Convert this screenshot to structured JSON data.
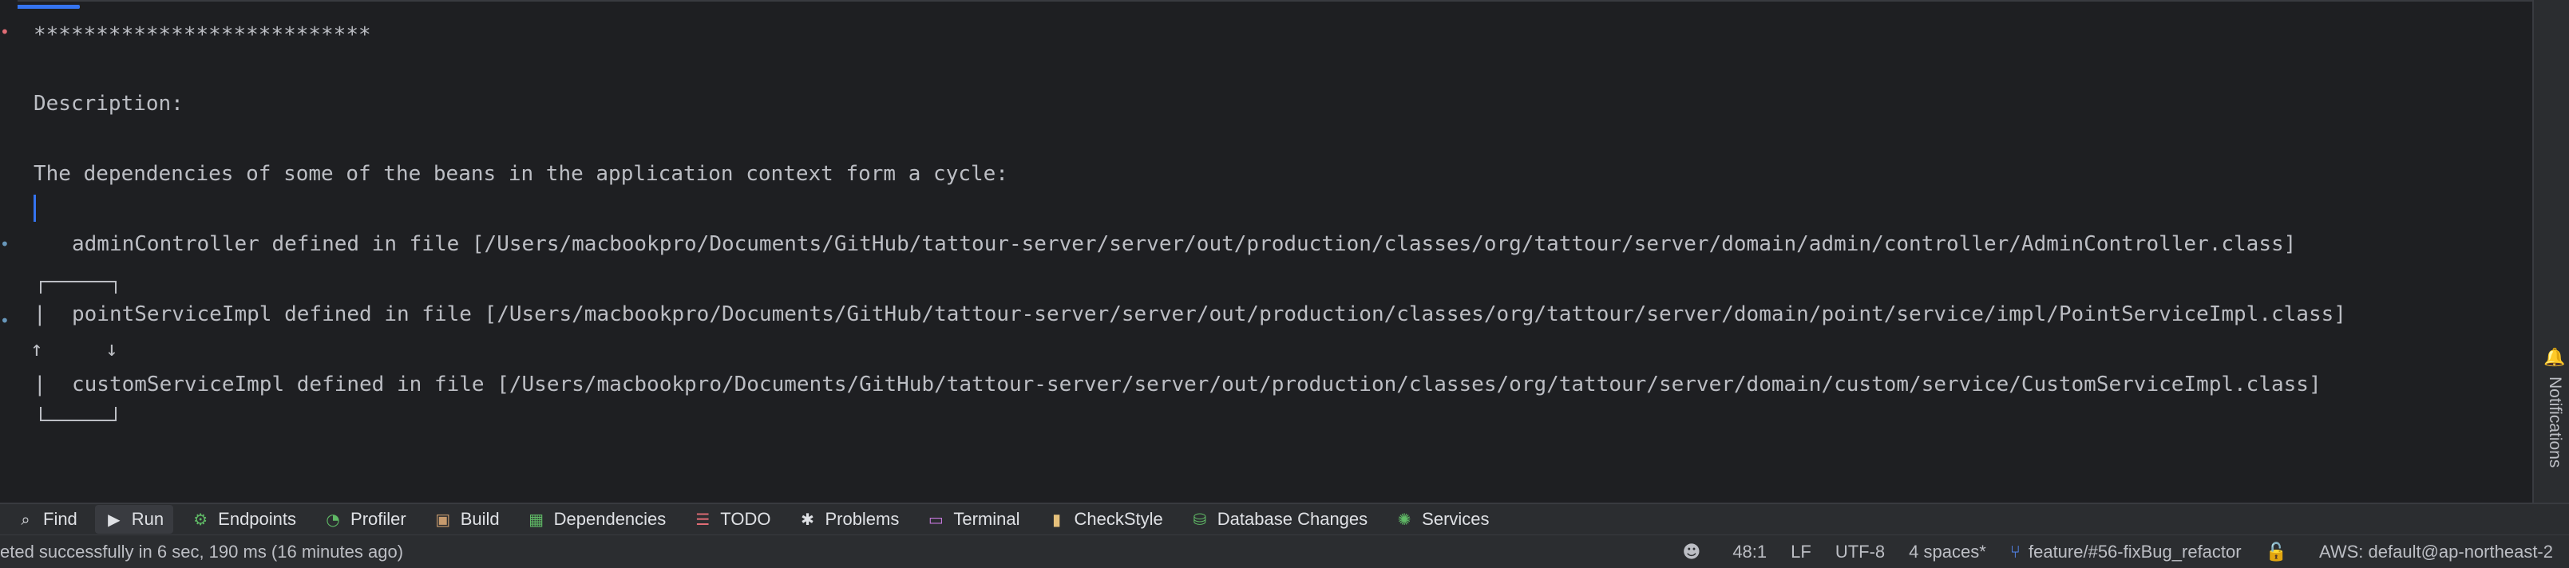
{
  "console": {
    "lines": [
      "***************************",
      "Description:",
      "The dependencies of some of the beans in the application context form a cycle:",
      "adminController defined in file [/Users/macbookpro/Documents/GitHub/tattour-server/server/out/production/classes/org/tattour/server/domain/admin/controller/AdminController.class]",
      "pointServiceImpl defined in file [/Users/macbookpro/Documents/GitHub/tattour-server/server/out/production/classes/org/tattour/server/domain/point/service/impl/PointServiceImpl.class]",
      "customServiceImpl defined in file [/Users/macbookpro/Documents/GitHub/tattour-server/server/out/production/classes/org/tattour/server/domain/custom/service/CustomServiceImpl.class]"
    ],
    "cycle_glyphs": {
      "bar": "|",
      "up": "↑",
      "down": "↓"
    }
  },
  "right_strip": {
    "notifications_label": "Notifications",
    "icon": "notifications-icon"
  },
  "tool_windows": [
    {
      "label": "Find",
      "icon": "search-icon",
      "active": false
    },
    {
      "label": "Run",
      "icon": "run-icon",
      "active": true
    },
    {
      "label": "Endpoints",
      "icon": "endpoints-icon",
      "active": false
    },
    {
      "label": "Profiler",
      "icon": "profiler-icon",
      "active": false
    },
    {
      "label": "Build",
      "icon": "build-icon",
      "active": false
    },
    {
      "label": "Dependencies",
      "icon": "dependencies-icon",
      "active": false
    },
    {
      "label": "TODO",
      "icon": "todo-icon",
      "active": false
    },
    {
      "label": "Problems",
      "icon": "problems-icon",
      "active": false
    },
    {
      "label": "Terminal",
      "icon": "terminal-icon",
      "active": false
    },
    {
      "label": "CheckStyle",
      "icon": "checkstyle-icon",
      "active": false
    },
    {
      "label": "Database Changes",
      "icon": "database-changes-icon",
      "active": false
    },
    {
      "label": "Services",
      "icon": "services-icon",
      "active": false
    }
  ],
  "status": {
    "message": "eted successfully in 6 sec, 190 ms (16 minutes ago)",
    "position": "48:1",
    "line_ending": "LF",
    "encoding": "UTF-8",
    "indent": "4 spaces*",
    "branch": "feature/#56-fixBug_refactor",
    "aws": "AWS: default@ap-northeast-2"
  },
  "colors": {
    "console_bg": "#1e1f22",
    "panel_bg": "#2b2d30",
    "text": "#bcbec4",
    "accent": "#3574f0"
  }
}
